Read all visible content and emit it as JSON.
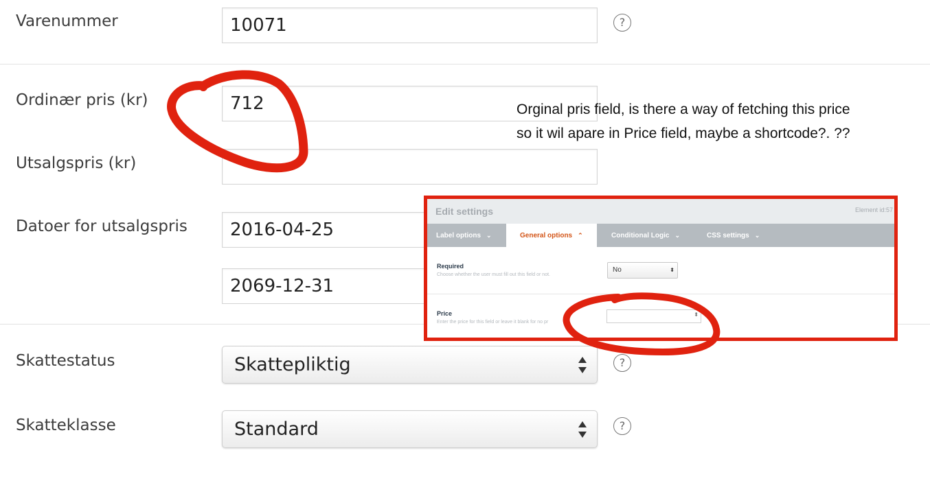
{
  "form": {
    "sku_label": "Varenummer",
    "sku_value": "10071",
    "regular_price_label": "Ordinær pris (kr)",
    "regular_price_value": "712",
    "sale_price_label": "Utsalgspris (kr)",
    "sale_price_value": "",
    "sale_dates_label": "Datoer for utsalgspris",
    "sale_date_from": "2016-04-25",
    "sale_date_to": "2069-12-31",
    "tax_status_label": "Skattestatus",
    "tax_status_value": "Skattepliktig",
    "tax_class_label": "Skatteklasse",
    "tax_class_value": "Standard",
    "help_glyph": "?"
  },
  "annotation": {
    "note_line1": "Orginal pris field, is there a way of fetching this price",
    "note_line2": "so it wil apare in Price field, maybe a shortcode?. ??",
    "highlight_color": "#e0220f"
  },
  "inset": {
    "title": "Edit settings",
    "element_id": "Element id:57",
    "tabs": [
      {
        "label": "Label options",
        "active": false
      },
      {
        "label": "General options",
        "active": true
      },
      {
        "label": "Conditional Logic",
        "active": false
      },
      {
        "label": "CSS settings",
        "active": false
      }
    ],
    "required_label": "Required",
    "required_desc": "Choose whether the user must fill out this field or not.",
    "required_value": "No",
    "price_label": "Price",
    "price_desc": "Enter the price for this field or leave it blank for no pr",
    "price_value": "",
    "accent_color": "#d35416"
  }
}
